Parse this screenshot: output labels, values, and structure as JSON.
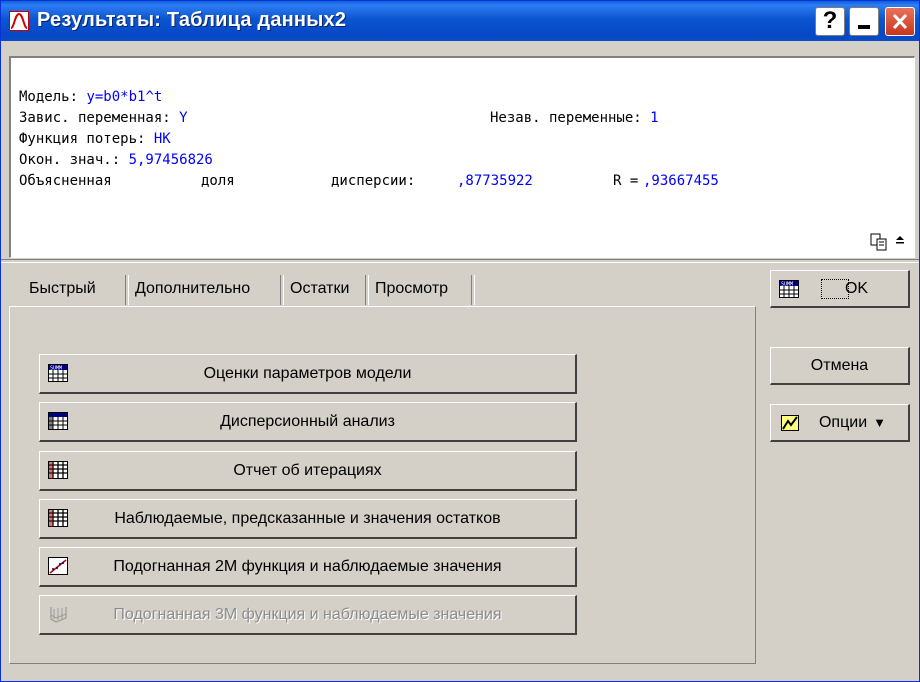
{
  "window": {
    "title": "Результаты: Таблица данных2",
    "help_label": "?",
    "accent": "#0a55d0"
  },
  "results": {
    "model_label": "Модель: ",
    "model_value": "y=b0*b1^t",
    "dep_label": "Завис. переменная: ",
    "dep_value": "Y",
    "indep_label": "Незав. переменные: ",
    "indep_value": "1",
    "loss_label": "Функция потерь: ",
    "loss_value": "НК",
    "final_label": "Окон. знач.: ",
    "final_value": "5,97456826",
    "expl_label_1": "Объясненная",
    "expl_label_2": "доля",
    "expl_label_3": "дисперсии: ",
    "expl_value": ",87735922",
    "r_label": "R =",
    "r_value": ",93667455",
    "copy_icon": "copy-icon",
    "expand_icon": "chevron-up-icon",
    "value_color": "#0000ff"
  },
  "tabs": [
    {
      "label": "Быстрый"
    },
    {
      "label": "Дополнительно"
    },
    {
      "label": "Остатки"
    },
    {
      "label": "Просмотр"
    }
  ],
  "buttons": [
    {
      "label": "Оценки параметров модели",
      "icon": "table-summary-icon",
      "enabled": true
    },
    {
      "label": "Дисперсионный анализ",
      "icon": "anova-table-icon",
      "enabled": true
    },
    {
      "label": "Отчет об итерациях",
      "icon": "spreadsheet-icon",
      "enabled": true
    },
    {
      "label": "Наблюдаемые, предсказанные и значения остатков",
      "icon": "spreadsheet-icon",
      "enabled": true
    },
    {
      "label": "Подогнанная 2М функция и наблюдаемые значения",
      "icon": "line-plot-icon",
      "enabled": true
    },
    {
      "label": "Подогнанная 3М функция и наблюдаемые значения",
      "icon": "surface-plot-icon",
      "enabled": false
    }
  ],
  "side": {
    "ok_label": "OK",
    "cancel_label": "Отмена",
    "options_label": "Опции",
    "options_arrow": "▼"
  }
}
